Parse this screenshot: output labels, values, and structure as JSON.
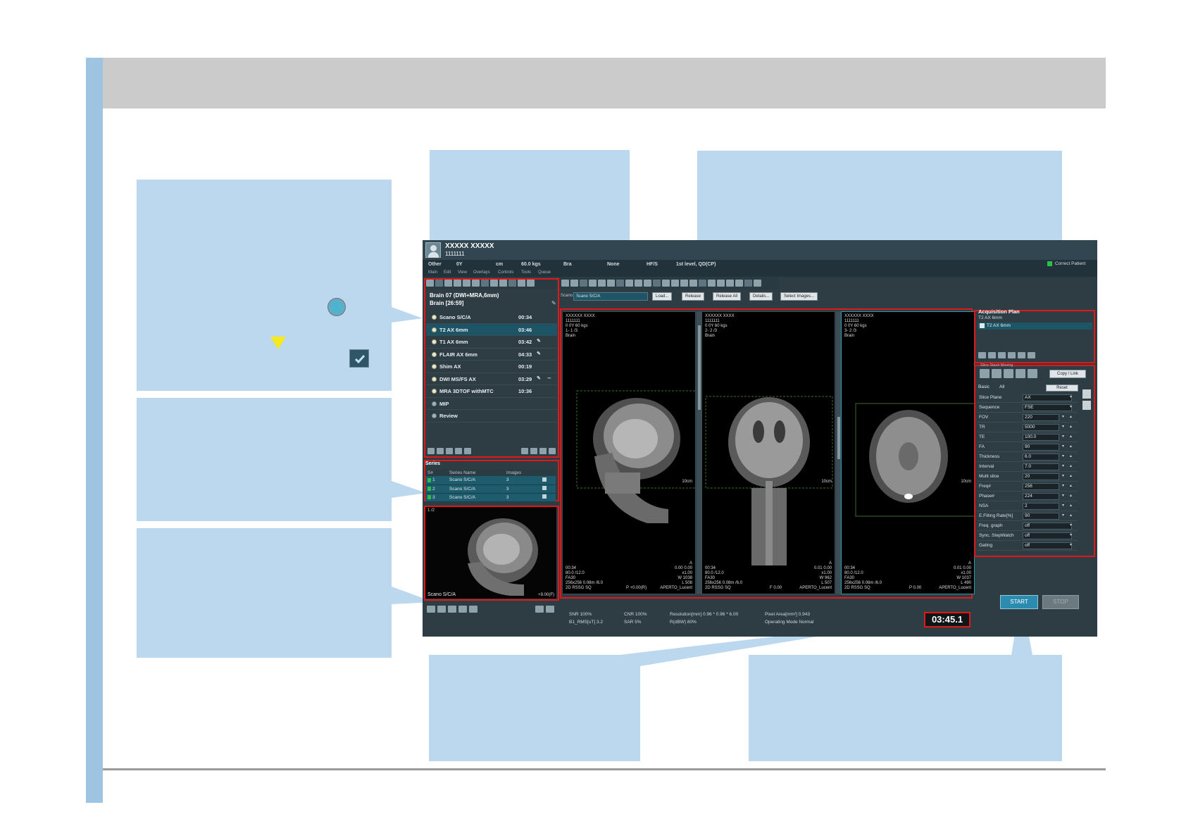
{
  "patient": {
    "name": "XXXXX XXXXX",
    "id": "1111111"
  },
  "infobar": {
    "category": "Other",
    "age": "0Y",
    "height_unit": "cm",
    "weight": "60.0 kgs",
    "region": "Bra",
    "coil": "None",
    "position": "HF/S",
    "level": "1st level, QD(CP)",
    "correct_patient": "Correct Patient"
  },
  "menu": [
    "Main",
    "Edit",
    "View",
    "Overlays",
    "Controls",
    "Tools",
    "Queue"
  ],
  "protocol": {
    "title": "Brain 07 (DWI+MRA,6mm)",
    "subtitle": "Brain [26:59]",
    "items": [
      {
        "label": "Scano S/C/A",
        "time": "00:34",
        "selected": false,
        "has_icon": false,
        "has_icon2": false,
        "sub": false
      },
      {
        "label": "T2 AX 6mm",
        "time": "03:46",
        "selected": true,
        "has_icon": false,
        "has_icon2": false,
        "sub": false
      },
      {
        "label": "T1 AX 6mm",
        "time": "03:42",
        "selected": false,
        "has_icon": true,
        "has_icon2": false,
        "sub": false
      },
      {
        "label": "FLAIR AX 6mm",
        "time": "04:33",
        "selected": false,
        "has_icon": true,
        "has_icon2": false,
        "sub": false
      },
      {
        "label": "Shim AX",
        "time": "00:19",
        "selected": false,
        "has_icon": false,
        "has_icon2": false,
        "sub": false
      },
      {
        "label": "DWI MS/FS AX",
        "time": "03:29",
        "selected": false,
        "has_icon": true,
        "has_icon2": true,
        "sub": false
      },
      {
        "label": "MRA 3DTOF withMTC",
        "time": "10:36",
        "selected": false,
        "has_icon": false,
        "has_icon2": false,
        "sub": false
      },
      {
        "label": "MIP",
        "time": "",
        "selected": false,
        "has_icon": false,
        "has_icon2": false,
        "sub": true
      },
      {
        "label": "Review",
        "time": "",
        "selected": false,
        "has_icon": false,
        "has_icon2": false,
        "sub": true
      }
    ]
  },
  "series": {
    "title": "Series",
    "columns": [
      "S#",
      "Series Name",
      "Images"
    ],
    "rows": [
      {
        "num": "1",
        "name": "Scano S/C/A",
        "images": "3"
      },
      {
        "num": "2",
        "name": "Scano S/C/A",
        "images": "3"
      },
      {
        "num": "3",
        "name": "Scano S/C/A",
        "images": "3"
      }
    ]
  },
  "thumbnail": {
    "index": "1 /2",
    "label": "Scano S/C/A",
    "zoom": "+9.00(F)"
  },
  "viewer": {
    "tag": "Scano",
    "selected_series": "Scano S/C/A",
    "buttons": [
      "Load...",
      "Release",
      "Release All",
      "Details...",
      "Select Images..."
    ]
  },
  "viewports": [
    {
      "top_left": "XXXXXX XXXX\n1111111\n0 0Y 60 kgs\n1- 1 /3\nBrain",
      "bottom_left": "00:34\n80.0 /12.0\nFA30\n256x256 0.08m /6.0\n2D RSSG SQ",
      "bottom_right": "A\n0.00 0.00\nx1.00\nW 1038\nL 508\nAPERTO_Lucent",
      "scale": "10cm",
      "extra": "P +0.00(R)"
    },
    {
      "top_left": "XXXXXX XXXX\n1111111\n0 0Y 60 kgs\n2- 2 /3\nBrain",
      "bottom_left": "00:34\n80.0 /12.0\nFA30\n256x256 0.08m /6.0\n2D RSSG SQ",
      "bottom_right": "A\n0.01 0.00\nx1.00\nW 962\nL 507\nAPERTO_Lucent",
      "scale": "10cm",
      "extra": "F 0.00"
    },
    {
      "top_left": "XXXXXX XXXX\n1111111\n0 0Y 60 kgs\n3- 2 /3\nBrain",
      "bottom_left": "00:34\n80.0 /12.0\nFA30\n256x256 0.08m /6.0\n2D RSSG SQ",
      "bottom_right": "A\n0.01 0.00\nx1.00\nW 1037\nL 490\nAPERTO_Lucent",
      "scale": "10cm",
      "extra": "P 0.00"
    }
  ],
  "status": {
    "snr": "SNR 100%",
    "cnr": "CNR 100%",
    "b1": "B1_RMS[uT] 3.2",
    "sar": "SAR 5%",
    "resolution": "Resolution[mm] 0.96 * 0.96 * 6.00",
    "rbw": "R(dBW) 80%",
    "pixel_area": "Pixel Area[mm²] 0.943",
    "operating_mode": "Operating Mode  Normal",
    "timer": "03:45.1"
  },
  "acquisition_plan": {
    "title": "Acquisition Plan",
    "item1": "T2 AX 6mm",
    "item2": "T2 AX 6mm",
    "slice_stack_label": "Slice Stack Moving",
    "copy_link": "Copy / Link",
    "tab_basic": "Basic",
    "tab_all": "All",
    "reset": "Reset",
    "params": [
      {
        "name": "Slice Plane",
        "value": "AX",
        "kind": "select"
      },
      {
        "name": "Sequence",
        "value": "FSE",
        "kind": "select"
      },
      {
        "name": "FOV",
        "value": "220",
        "kind": "spin"
      },
      {
        "name": "TR",
        "value": "5000",
        "kind": "spin"
      },
      {
        "name": "TE",
        "value": "100.0",
        "kind": "spin"
      },
      {
        "name": "FA",
        "value": "90",
        "kind": "spin"
      },
      {
        "name": "Thickness",
        "value": "6.0",
        "kind": "spin"
      },
      {
        "name": "Interval",
        "value": "7.0",
        "kind": "spin"
      },
      {
        "name": "Multi slice",
        "value": "20",
        "kind": "spin"
      },
      {
        "name": "Freq#",
        "value": "256",
        "kind": "spin"
      },
      {
        "name": "Phase#",
        "value": "224",
        "kind": "spin"
      },
      {
        "name": "NSA",
        "value": "2",
        "kind": "spin"
      },
      {
        "name": "E.Filling Rate[%]",
        "value": "90",
        "kind": "spin"
      },
      {
        "name": "Freq. graph",
        "value": "off",
        "kind": "select"
      },
      {
        "name": "Sync. StepWatch",
        "value": "off",
        "kind": "select"
      },
      {
        "name": "Gating",
        "value": "off",
        "kind": "select"
      }
    ],
    "start": "START",
    "stop": "STOP"
  },
  "icons": {
    "arrow_down": "↓",
    "arrow_up": "↑",
    "spin_down": "▾",
    "spin_up": "▴",
    "edit": "✎",
    "wave": "∼"
  },
  "colors": {
    "callout": "#bcd8ee",
    "highlight": "#e01818",
    "selected_row": "#1d5466",
    "legend_triangle": "#f6ea1c",
    "legend_circle": "#4fb3d0"
  }
}
